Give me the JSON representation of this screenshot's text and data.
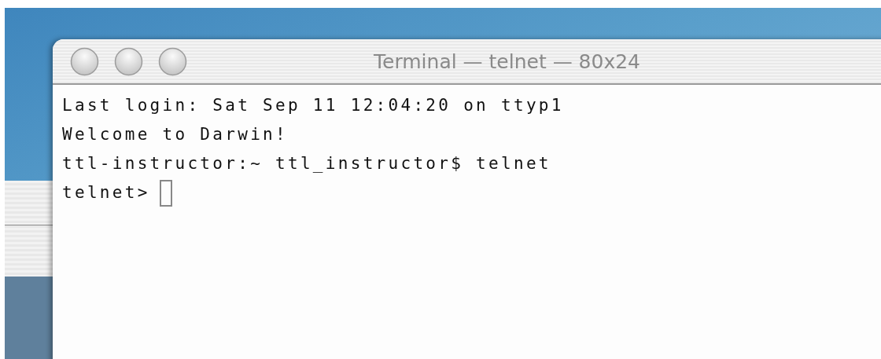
{
  "window": {
    "title": "Terminal — telnet — 80x24"
  },
  "terminal": {
    "lines": [
      "Last login: Sat Sep 11 12:04:20 on ttyp1",
      "Welcome to Darwin!",
      "ttl-instructor:~ ttl_instructor$ telnet"
    ],
    "prompt": "telnet>"
  }
}
